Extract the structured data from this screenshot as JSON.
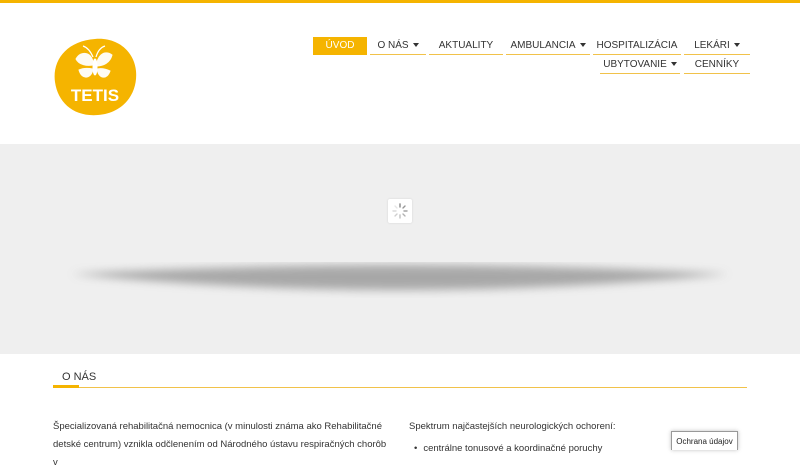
{
  "brand": {
    "logo_text": "TETIS",
    "accent_color": "#f5b400"
  },
  "nav": {
    "row1": [
      {
        "label": "ÚVOD",
        "dropdown": false,
        "active": true
      },
      {
        "label": "O NÁS",
        "dropdown": true,
        "active": false
      },
      {
        "label": "AKTUALITY",
        "dropdown": false,
        "active": false
      },
      {
        "label": "AMBULANCIA",
        "dropdown": true,
        "active": false
      },
      {
        "label": "HOSPITALIZÁCIA",
        "dropdown": false,
        "active": false
      },
      {
        "label": "LEKÁRI",
        "dropdown": true,
        "active": false
      }
    ],
    "row2": [
      {
        "label": "UBYTOVANIE",
        "dropdown": true,
        "active": false
      },
      {
        "label": "CENNÍKY",
        "dropdown": false,
        "active": false
      }
    ]
  },
  "hero": {
    "loading_icon": "spinner-icon"
  },
  "section": {
    "title": "O NÁS"
  },
  "content": {
    "left_text": "Špecializovaná rehabilitačná nemocnica (v minulosti známa ako Rehabilitačné detské centrum) vznikla odčlenením od Národného ústavu respiračných chorôb v",
    "right_text": "Spektrum najčastejších neurologických ochorení:",
    "list_item": "centrálne tonusové a koordinačné poruchy"
  },
  "privacy_button": {
    "label": "Ochrana údajov"
  }
}
